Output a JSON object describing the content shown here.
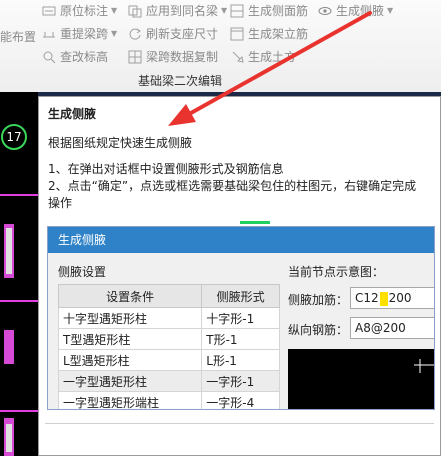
{
  "ribbon": {
    "buttons": {
      "yuanwei": "原位标注",
      "apply_same": "应用到同名梁",
      "gen_side_rebar": "生成侧面筋",
      "gen_haunch": "生成侧腋",
      "redo_span": "重提梁跨",
      "refresh_support": "刷新支座尺寸",
      "gen_stand_rebar": "生成架立筋",
      "check_elev": "查改标高",
      "span_copy": "梁跨数据复制",
      "gen_soil": "生成土方"
    },
    "left_cut_text": "能布置",
    "group_label": "基础梁二次编辑"
  },
  "canvas": {
    "axis_number": "17"
  },
  "tooltip": {
    "title": "生成侧腋",
    "description": "根据图纸规定快速生成侧腋",
    "step1": "1、在弹出对话框中设置侧腋形式及钢筋信息",
    "step2_line1": "2、点击“确定”，点选或框选需要基础梁包住的柱图元，右键确定完成",
    "step2_line2": "操作"
  },
  "dialog": {
    "title": "生成侧腋",
    "settings_label": "侧腋设置",
    "table": {
      "headers": [
        "设置条件",
        "侧腋形式"
      ],
      "rows": [
        [
          "十字型遇矩形柱",
          "十字形-1"
        ],
        [
          "T型遇矩形柱",
          "T形-1"
        ],
        [
          "L型遇矩形柱",
          "L形-1"
        ],
        [
          "一字型遇矩形柱",
          "一字形-1"
        ],
        [
          "一字型遇矩形端柱",
          "一字形-4"
        ]
      ]
    },
    "preview_label": "当前节点示意图：",
    "haunch_rebar_label": "侧腋加筋：",
    "haunch_rebar_before": "C12",
    "haunch_rebar_after": "200",
    "long_rebar_label": "纵向钢筋：",
    "long_rebar_value": "A8@200"
  },
  "colors": {
    "arrow": "#e8332f",
    "dialog_title_bg": "#2f82c8",
    "canvas_bg": "#000000",
    "column_magenta": "#d64bd6",
    "axis_green": "#39d65a"
  }
}
